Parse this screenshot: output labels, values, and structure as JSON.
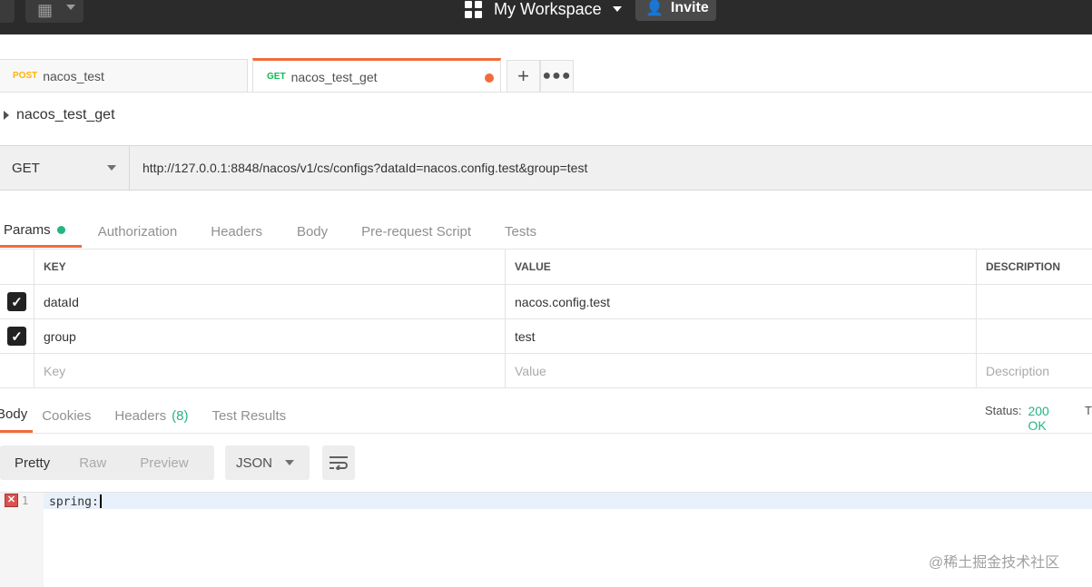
{
  "topbar": {
    "workspace_label": "My Workspace",
    "invite_label": "Invite",
    "new_icon": "plus-box-icon",
    "workspace_icon": "grid-icon",
    "invite_icon": "add-user-icon"
  },
  "tabs": [
    {
      "method": "POST",
      "name": "nacos_test"
    },
    {
      "method": "GET",
      "name": "nacos_test_get",
      "unsaved": true
    }
  ],
  "request": {
    "name": "nacos_test_get",
    "method": "GET",
    "url": "http://127.0.0.1:8848/nacos/v1/cs/configs?dataId=nacos.config.test&group=test"
  },
  "request_tabs": [
    "Params",
    "Authorization",
    "Headers",
    "Body",
    "Pre-request Script",
    "Tests"
  ],
  "params": {
    "headers": {
      "key": "KEY",
      "value": "VALUE",
      "description": "DESCRIPTION"
    },
    "rows": [
      {
        "checked": true,
        "key": "dataId",
        "value": "nacos.config.test"
      },
      {
        "checked": true,
        "key": "group",
        "value": "test"
      }
    ],
    "placeholders": {
      "key": "Key",
      "value": "Value",
      "description": "Description"
    }
  },
  "response": {
    "tabs": {
      "body": "Body",
      "cookies": "Cookies",
      "headers": "Headers",
      "headers_count": "(8)",
      "test_results": "Test Results"
    },
    "status_label": "Status:",
    "status_code": "200 OK",
    "status_cut": "T",
    "formats": [
      "Pretty",
      "Raw",
      "Preview"
    ],
    "language": "JSON",
    "line_number": "1",
    "code": "spring:"
  },
  "watermark": "@稀土掘金技术社区",
  "colors": {
    "accent": "#f26b3a",
    "success": "#26b47f",
    "post": "#ffb400",
    "get": "#0cbb52",
    "topbar": "#2b2b2b"
  }
}
